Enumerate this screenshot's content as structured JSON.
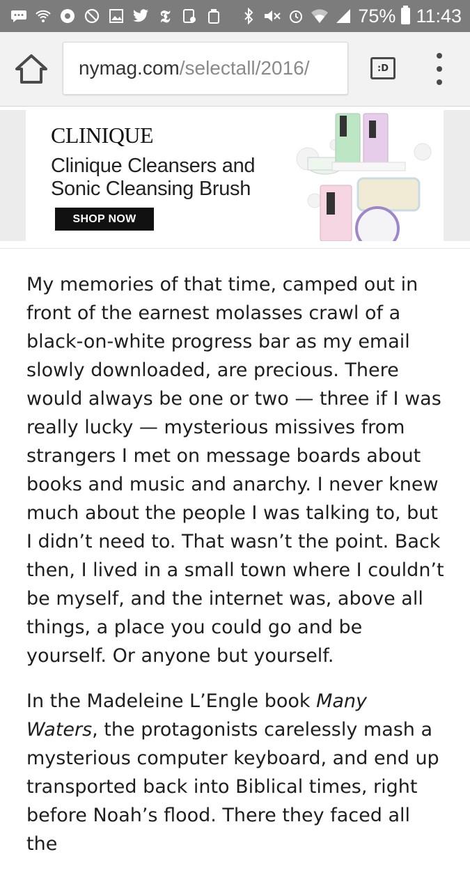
{
  "status_bar": {
    "left_icons": [
      "message-icon",
      "wifi-calling-icon",
      "settings-icon",
      "sync-icon",
      "image-icon",
      "twitter-icon",
      "nytimes-icon",
      "screenshot-icon",
      "recycle-icon"
    ],
    "right_icons": [
      "bluetooth-icon",
      "mute-icon",
      "alarm-icon",
      "wifi-icon",
      "signal-icon"
    ],
    "battery": "75%",
    "time": "11:43"
  },
  "browser": {
    "url_domain": "nymag.com",
    "url_path": "/selectall/2016/",
    "tabs_label": ":D"
  },
  "ad": {
    "brand": "CLINIQUE",
    "line1": "Clinique Cleansers and",
    "line2": "Sonic Cleansing Brush",
    "cta": "SHOP NOW"
  },
  "article": {
    "p1": "My memories of that time, camped out in front of the earnest molasses crawl of a black-on-white progress bar as my email slowly downloaded, are precious. There would always be one or two — three if I was really lucky — mysterious missives from strangers I met on message boards about books and music and anarchy. I never knew much about the people I was talking to, but I didn’t need to. That wasn’t the point. Back then, I lived in a small town where I couldn’t be myself, and the internet was, above all things, a place you could go and be yourself. Or anyone but yourself.",
    "p2_before": "In the Madeleine L’Engle book ",
    "p2_title": "Many Waters",
    "p2_after": ", the protagonists carelessly mash a mysterious computer keyboard, and end up transported back into Biblical times, right before Noah’s flood. There they faced all the"
  }
}
